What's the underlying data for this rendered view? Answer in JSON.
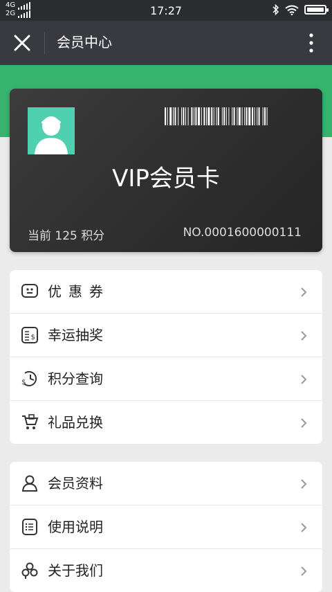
{
  "status_bar": {
    "network_1": "4G",
    "network_2": "2G",
    "time": "17:27",
    "icons": [
      "bluetooth-icon",
      "wifi-icon",
      "battery-icon"
    ]
  },
  "header": {
    "title": "会员中心",
    "close_icon": "close-icon",
    "more_icon": "more-vertical-icon"
  },
  "card": {
    "title": "VIP会员卡",
    "points_text": "当前 125 积分",
    "number_text": "NO.0001600000111",
    "avatar_icon": "user-avatar-icon",
    "barcode_icon": "barcode-icon"
  },
  "menu_groups": [
    [
      {
        "label": "优惠券",
        "icon": "coupon-icon"
      },
      {
        "label": "幸运抽奖",
        "icon": "lottery-icon"
      },
      {
        "label": "积分查询",
        "icon": "points-history-icon"
      },
      {
        "label": "礼品兑换",
        "icon": "gift-cart-icon"
      }
    ],
    [
      {
        "label": "会员资料",
        "icon": "user-profile-icon"
      },
      {
        "label": "使用说明",
        "icon": "instructions-icon"
      },
      {
        "label": "关于我们",
        "icon": "about-us-icon"
      }
    ]
  ],
  "colors": {
    "header_bg": "#393a3f",
    "accent_green": "#36b36d",
    "avatar_bg": "#4fd0b0",
    "card_bg": "#2e2e2e"
  }
}
